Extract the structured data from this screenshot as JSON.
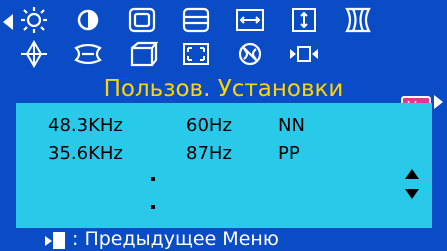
{
  "colors": {
    "background": "#0a4cc6",
    "panel": "#29c9ea",
    "title": "#ffd400",
    "hz_badge": "#e0388c"
  },
  "menu": {
    "icons_row1": [
      "brightness-icon",
      "contrast-icon",
      "h-size-icon",
      "v-size-icon",
      "h-position-icon",
      "v-position-icon",
      "pincushion-icon"
    ],
    "icons_row2": [
      "rotation-icon",
      "trapezoid-icon",
      "parallelogram-icon",
      "zoom-icon",
      "degauss-icon",
      "moire-icon",
      "hz-icon"
    ],
    "hz_label": "Hz",
    "selected": "hz-icon"
  },
  "title": "Пользов. Установки",
  "modes": [
    {
      "h_freq": "48.3KHz",
      "v_freq": "60Hz",
      "polarity": "NN"
    },
    {
      "h_freq": "35.6KHz",
      "v_freq": "87Hz",
      "polarity": "PP"
    }
  ],
  "footer": {
    "text": ": Предыдущее Меню"
  }
}
